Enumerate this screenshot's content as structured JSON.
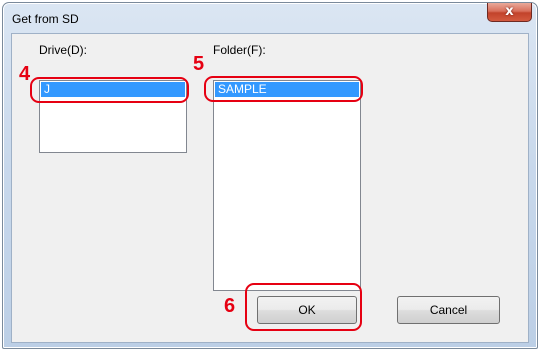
{
  "window": {
    "title": "Get from SD",
    "close_symbol": "x"
  },
  "drive": {
    "label": "Drive(D):",
    "items": [
      "J"
    ],
    "selected": "J"
  },
  "folder": {
    "label": "Folder(F):",
    "items": [
      "SAMPLE"
    ],
    "selected": "SAMPLE"
  },
  "buttons": {
    "ok_label": "OK",
    "cancel_label": "Cancel"
  },
  "annotations": {
    "step4": "4",
    "step5": "5",
    "step6": "6"
  },
  "colors": {
    "selection": "#3399ff",
    "annotation": "#e60012"
  }
}
